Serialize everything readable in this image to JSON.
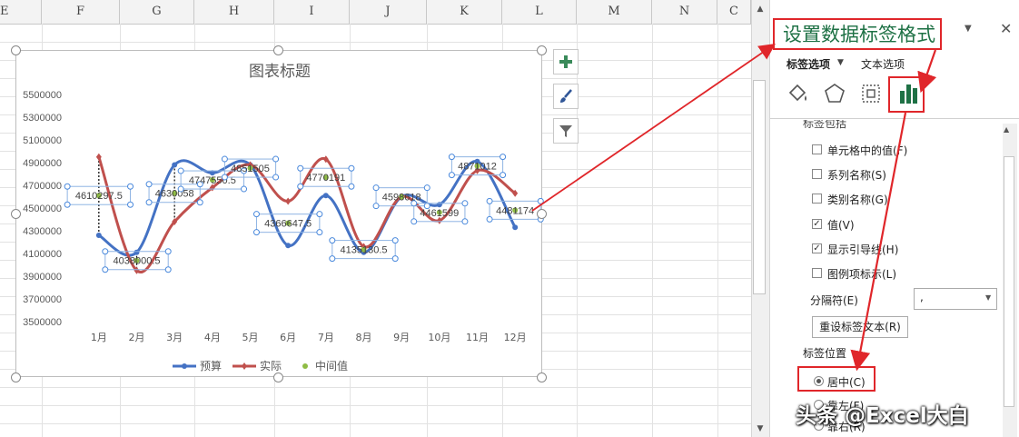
{
  "columns": [
    "E",
    "F",
    "G",
    "H",
    "I",
    "J",
    "K",
    "L",
    "M",
    "N",
    "C"
  ],
  "chart": {
    "title": "图表标题",
    "side_buttons": [
      "plus-icon",
      "brush-icon",
      "filter-icon"
    ]
  },
  "chart_data": {
    "type": "line",
    "title": "图表标题",
    "categories": [
      "1月",
      "2月",
      "3月",
      "4月",
      "5月",
      "6月",
      "7月",
      "8月",
      "9月",
      "10月",
      "11月",
      "12月"
    ],
    "ylim": [
      3500000,
      5500000
    ],
    "yticks": [
      "5500000",
      "5300000",
      "5100000",
      "4900000",
      "4700000",
      "4500000",
      "4300000",
      "4100000",
      "3900000",
      "3700000",
      "3500000"
    ],
    "series": [
      {
        "name": "预算",
        "color": "#4472c4",
        "values": [
          4260000,
          4110000,
          4880000,
          4810000,
          4880000,
          4170000,
          4610000,
          4110000,
          4600000,
          4530000,
          4910000,
          4330000
        ]
      },
      {
        "name": "实际",
        "color": "#c0504d",
        "values": [
          4950000,
          3950000,
          4380000,
          4680000,
          4880000,
          4560000,
          4930000,
          4160000,
          4600000,
          4390000,
          4830000,
          4630000
        ]
      },
      {
        "name": "中间值",
        "color": "#8fbc45",
        "values": [
          4610297.5,
          4038000.5,
          4630058,
          4747550.5,
          4851505,
          4366647.5,
          4770191,
          4135130.5,
          4598618,
          4461599,
          4871012,
          4481174
        ]
      }
    ],
    "data_labels": [
      "4610297.5",
      "4038000.5",
      "4630058",
      "4747550.5",
      "4851505",
      "4366647.5",
      "4770191",
      "4135130.5",
      "4598618",
      "4461599",
      "4871012",
      "4481174"
    ],
    "legend_position": "bottom",
    "grid": false
  },
  "pane": {
    "title": "设置数据标签格式",
    "tab_label_options": "标签选项",
    "tab_text_options": "文本选项",
    "icons": [
      "fill-icon",
      "pentagon-icon",
      "size-icon",
      "bar-chart-icon"
    ],
    "section": "标签包括",
    "checkboxes": [
      {
        "label": "单元格中的值(F)",
        "checked": false
      },
      {
        "label": "系列名称(S)",
        "checked": false
      },
      {
        "label": "类别名称(G)",
        "checked": false
      },
      {
        "label": "值(V)",
        "checked": true
      },
      {
        "label": "显示引导线(H)",
        "checked": true
      },
      {
        "label": "图例项标示(L)",
        "checked": false
      }
    ],
    "separator_label": "分隔符(E)",
    "separator_value": ",",
    "reset_button": "重设标签文本(R)",
    "position_label": "标签位置",
    "radios": [
      {
        "label": "居中(C)",
        "selected": true
      },
      {
        "label": "靠左(F)",
        "selected": false
      },
      {
        "label": "靠右(R)",
        "selected": false
      }
    ]
  },
  "watermark": "头条 @Excel大白"
}
